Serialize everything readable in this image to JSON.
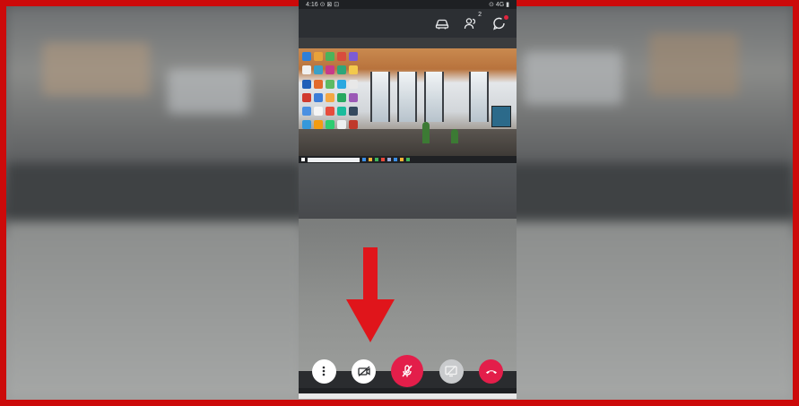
{
  "status_bar": {
    "left": "4:16 ⊙ ⊠ ⊡",
    "right": "⊙ 4G ▮"
  },
  "top_bar": {
    "icons": [
      "car-icon",
      "participants-icon",
      "chat-icon"
    ],
    "participants_count": "2"
  },
  "controls": {
    "buttons": [
      "more-icon",
      "camera-off-icon",
      "mic-muted-icon",
      "share-screen-icon",
      "hang-up-icon"
    ]
  },
  "colors": {
    "frame_border": "#cc0a0a",
    "accent_red": "#e31e4a",
    "arrow_red": "#e0151b",
    "phone_bg": "#2a2c2f"
  }
}
